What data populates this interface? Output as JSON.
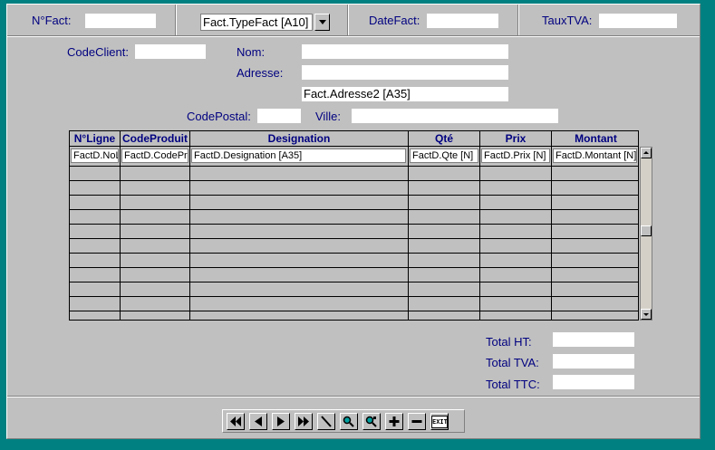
{
  "header": {
    "nfact_label": "N°Fact:",
    "typefact_value": "Fact.TypeFact [A10]",
    "datefact_label": "DateFact:",
    "tauxtva_label": "TauxTVA:"
  },
  "client": {
    "codeclient_label": "CodeClient:",
    "nom_label": "Nom:",
    "adresse_label": "Adresse:",
    "adresse2_value": "Fact.Adresse2 [A35]",
    "codepostal_label": "CodePostal:",
    "ville_label": "Ville:"
  },
  "table": {
    "columns": [
      "N°Ligne",
      "CodeProduit",
      "Designation",
      "Qté",
      "Prix",
      "Montant"
    ],
    "first_row": [
      "FactD.NoL",
      "FactD.CodePro",
      "FactD.Designation [A35]",
      "FactD.Qte [N]",
      "FactD.Prix [N]",
      "FactD.Montant [N]"
    ]
  },
  "totals": {
    "total_ht_label": "Total HT:",
    "total_tva_label": "Total TVA:",
    "total_ttc_label": "Total TTC:"
  },
  "nav": {
    "icons": [
      "first-record-icon",
      "prev-record-icon",
      "next-record-icon",
      "last-record-icon",
      "edit-icon",
      "search-icon",
      "search-next-icon",
      "add-record-icon",
      "delete-record-icon",
      "exit-icon"
    ],
    "exit_label": "EXIT"
  },
  "colors": {
    "background": "#008080",
    "panel": "#c0c0c0",
    "label": "#000080"
  }
}
